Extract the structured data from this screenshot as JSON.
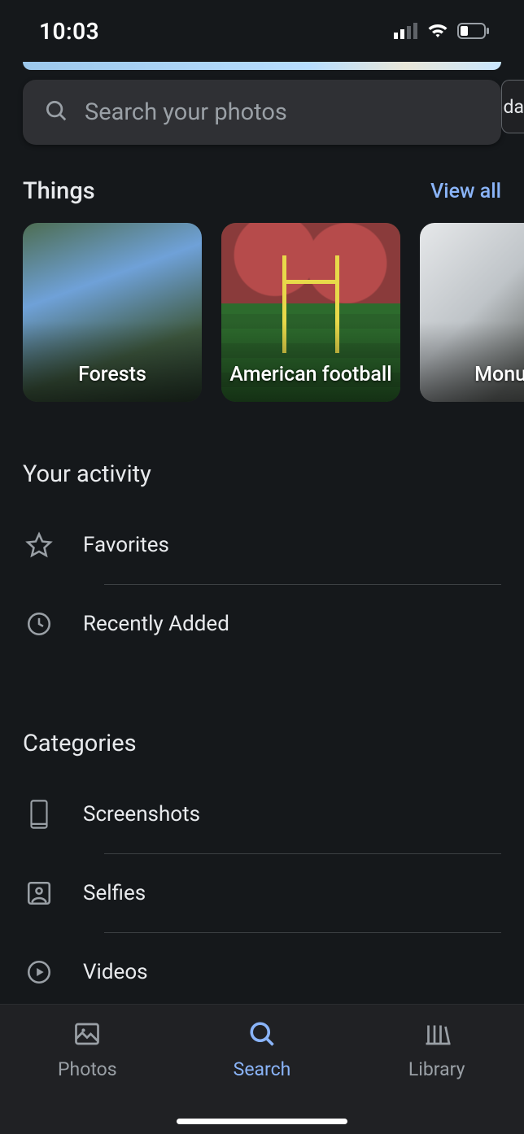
{
  "status": {
    "time": "10:03"
  },
  "search": {
    "placeholder": "Search your photos"
  },
  "side_pill": {
    "text": "nda"
  },
  "things": {
    "title": "Things",
    "view_all": "View all",
    "items": [
      {
        "label": "Forests"
      },
      {
        "label": "American football"
      },
      {
        "label": "Monum"
      }
    ]
  },
  "activity": {
    "title": "Your activity",
    "items": [
      {
        "label": "Favorites",
        "icon": "star-icon"
      },
      {
        "label": "Recently Added",
        "icon": "clock-icon"
      }
    ]
  },
  "categories": {
    "title": "Categories",
    "items": [
      {
        "label": "Screenshots",
        "icon": "phone-icon"
      },
      {
        "label": "Selfies",
        "icon": "selfie-icon"
      },
      {
        "label": "Videos",
        "icon": "play-circle-icon"
      }
    ]
  },
  "nav": {
    "items": [
      {
        "label": "Photos",
        "icon": "image-icon",
        "active": false
      },
      {
        "label": "Search",
        "icon": "search-icon",
        "active": true
      },
      {
        "label": "Library",
        "icon": "library-icon",
        "active": false
      }
    ]
  }
}
